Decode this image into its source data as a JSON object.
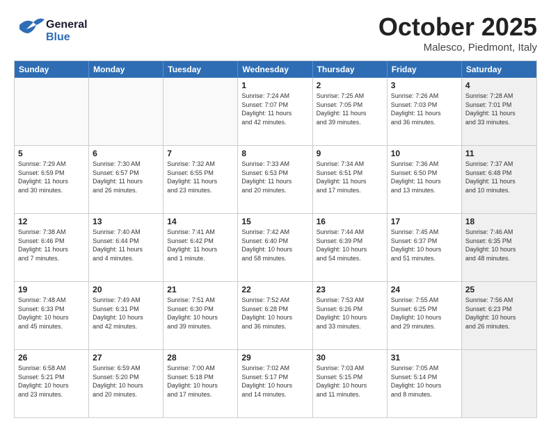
{
  "header": {
    "logo_general": "General",
    "logo_blue": "Blue",
    "month": "October 2025",
    "location": "Malesco, Piedmont, Italy"
  },
  "weekdays": [
    "Sunday",
    "Monday",
    "Tuesday",
    "Wednesday",
    "Thursday",
    "Friday",
    "Saturday"
  ],
  "rows": [
    [
      {
        "day": "",
        "info": "",
        "empty": true
      },
      {
        "day": "",
        "info": "",
        "empty": true
      },
      {
        "day": "",
        "info": "",
        "empty": true
      },
      {
        "day": "1",
        "info": "Sunrise: 7:24 AM\nSunset: 7:07 PM\nDaylight: 11 hours\nand 42 minutes.",
        "empty": false
      },
      {
        "day": "2",
        "info": "Sunrise: 7:25 AM\nSunset: 7:05 PM\nDaylight: 11 hours\nand 39 minutes.",
        "empty": false
      },
      {
        "day": "3",
        "info": "Sunrise: 7:26 AM\nSunset: 7:03 PM\nDaylight: 11 hours\nand 36 minutes.",
        "empty": false
      },
      {
        "day": "4",
        "info": "Sunrise: 7:28 AM\nSunset: 7:01 PM\nDaylight: 11 hours\nand 33 minutes.",
        "empty": false,
        "shaded": true
      }
    ],
    [
      {
        "day": "5",
        "info": "Sunrise: 7:29 AM\nSunset: 6:59 PM\nDaylight: 11 hours\nand 30 minutes.",
        "empty": false
      },
      {
        "day": "6",
        "info": "Sunrise: 7:30 AM\nSunset: 6:57 PM\nDaylight: 11 hours\nand 26 minutes.",
        "empty": false
      },
      {
        "day": "7",
        "info": "Sunrise: 7:32 AM\nSunset: 6:55 PM\nDaylight: 11 hours\nand 23 minutes.",
        "empty": false
      },
      {
        "day": "8",
        "info": "Sunrise: 7:33 AM\nSunset: 6:53 PM\nDaylight: 11 hours\nand 20 minutes.",
        "empty": false
      },
      {
        "day": "9",
        "info": "Sunrise: 7:34 AM\nSunset: 6:51 PM\nDaylight: 11 hours\nand 17 minutes.",
        "empty": false
      },
      {
        "day": "10",
        "info": "Sunrise: 7:36 AM\nSunset: 6:50 PM\nDaylight: 11 hours\nand 13 minutes.",
        "empty": false
      },
      {
        "day": "11",
        "info": "Sunrise: 7:37 AM\nSunset: 6:48 PM\nDaylight: 11 hours\nand 10 minutes.",
        "empty": false,
        "shaded": true
      }
    ],
    [
      {
        "day": "12",
        "info": "Sunrise: 7:38 AM\nSunset: 6:46 PM\nDaylight: 11 hours\nand 7 minutes.",
        "empty": false
      },
      {
        "day": "13",
        "info": "Sunrise: 7:40 AM\nSunset: 6:44 PM\nDaylight: 11 hours\nand 4 minutes.",
        "empty": false
      },
      {
        "day": "14",
        "info": "Sunrise: 7:41 AM\nSunset: 6:42 PM\nDaylight: 11 hours\nand 1 minute.",
        "empty": false
      },
      {
        "day": "15",
        "info": "Sunrise: 7:42 AM\nSunset: 6:40 PM\nDaylight: 10 hours\nand 58 minutes.",
        "empty": false
      },
      {
        "day": "16",
        "info": "Sunrise: 7:44 AM\nSunset: 6:39 PM\nDaylight: 10 hours\nand 54 minutes.",
        "empty": false
      },
      {
        "day": "17",
        "info": "Sunrise: 7:45 AM\nSunset: 6:37 PM\nDaylight: 10 hours\nand 51 minutes.",
        "empty": false
      },
      {
        "day": "18",
        "info": "Sunrise: 7:46 AM\nSunset: 6:35 PM\nDaylight: 10 hours\nand 48 minutes.",
        "empty": false,
        "shaded": true
      }
    ],
    [
      {
        "day": "19",
        "info": "Sunrise: 7:48 AM\nSunset: 6:33 PM\nDaylight: 10 hours\nand 45 minutes.",
        "empty": false
      },
      {
        "day": "20",
        "info": "Sunrise: 7:49 AM\nSunset: 6:31 PM\nDaylight: 10 hours\nand 42 minutes.",
        "empty": false
      },
      {
        "day": "21",
        "info": "Sunrise: 7:51 AM\nSunset: 6:30 PM\nDaylight: 10 hours\nand 39 minutes.",
        "empty": false
      },
      {
        "day": "22",
        "info": "Sunrise: 7:52 AM\nSunset: 6:28 PM\nDaylight: 10 hours\nand 36 minutes.",
        "empty": false
      },
      {
        "day": "23",
        "info": "Sunrise: 7:53 AM\nSunset: 6:26 PM\nDaylight: 10 hours\nand 33 minutes.",
        "empty": false
      },
      {
        "day": "24",
        "info": "Sunrise: 7:55 AM\nSunset: 6:25 PM\nDaylight: 10 hours\nand 29 minutes.",
        "empty": false
      },
      {
        "day": "25",
        "info": "Sunrise: 7:56 AM\nSunset: 6:23 PM\nDaylight: 10 hours\nand 26 minutes.",
        "empty": false,
        "shaded": true
      }
    ],
    [
      {
        "day": "26",
        "info": "Sunrise: 6:58 AM\nSunset: 5:21 PM\nDaylight: 10 hours\nand 23 minutes.",
        "empty": false
      },
      {
        "day": "27",
        "info": "Sunrise: 6:59 AM\nSunset: 5:20 PM\nDaylight: 10 hours\nand 20 minutes.",
        "empty": false
      },
      {
        "day": "28",
        "info": "Sunrise: 7:00 AM\nSunset: 5:18 PM\nDaylight: 10 hours\nand 17 minutes.",
        "empty": false
      },
      {
        "day": "29",
        "info": "Sunrise: 7:02 AM\nSunset: 5:17 PM\nDaylight: 10 hours\nand 14 minutes.",
        "empty": false
      },
      {
        "day": "30",
        "info": "Sunrise: 7:03 AM\nSunset: 5:15 PM\nDaylight: 10 hours\nand 11 minutes.",
        "empty": false
      },
      {
        "day": "31",
        "info": "Sunrise: 7:05 AM\nSunset: 5:14 PM\nDaylight: 10 hours\nand 8 minutes.",
        "empty": false
      },
      {
        "day": "",
        "info": "",
        "empty": true,
        "shaded": true
      }
    ]
  ]
}
